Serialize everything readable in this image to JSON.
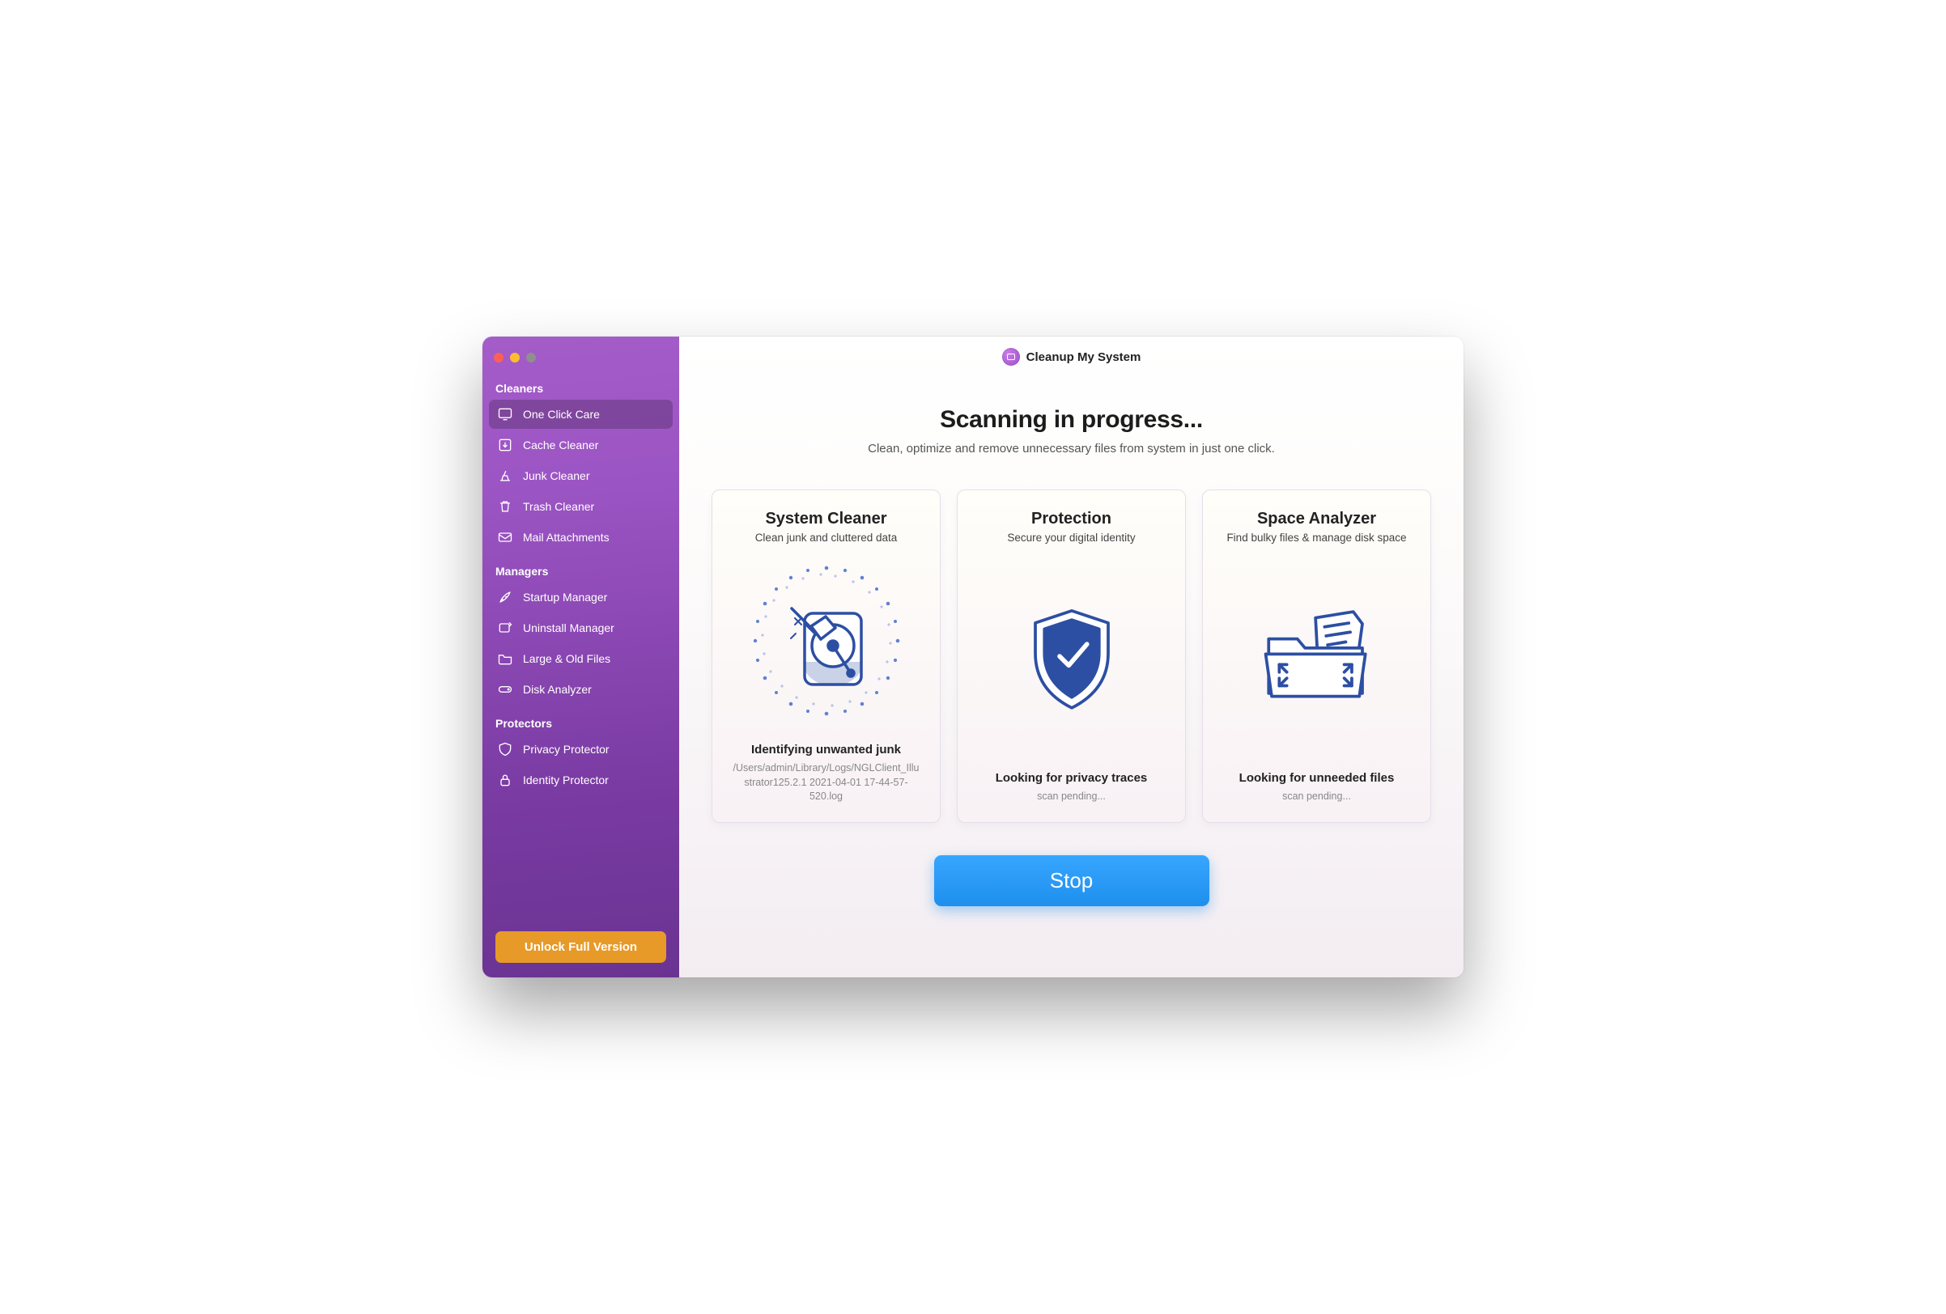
{
  "app": {
    "title": "Cleanup My System"
  },
  "sidebar": {
    "sections": [
      {
        "title": "Cleaners",
        "items": [
          {
            "label": "One Click Care",
            "active": true
          },
          {
            "label": "Cache Cleaner"
          },
          {
            "label": "Junk Cleaner"
          },
          {
            "label": "Trash Cleaner"
          },
          {
            "label": "Mail Attachments"
          }
        ]
      },
      {
        "title": "Managers",
        "items": [
          {
            "label": "Startup Manager"
          },
          {
            "label": "Uninstall Manager"
          },
          {
            "label": "Large & Old Files"
          },
          {
            "label": "Disk Analyzer"
          }
        ]
      },
      {
        "title": "Protectors",
        "items": [
          {
            "label": "Privacy Protector"
          },
          {
            "label": "Identity Protector"
          }
        ]
      }
    ],
    "unlock_label": "Unlock Full Version"
  },
  "hero": {
    "title": "Scanning in progress...",
    "subtitle": "Clean, optimize and remove unnecessary files from system in just one click."
  },
  "cards": [
    {
      "title": "System Cleaner",
      "subtitle": "Clean junk and cluttered data",
      "status": "Identifying unwanted junk",
      "detail": "/Users/admin/Library/Logs/NGLClient_Illustrator125.2.1 2021-04-01 17-44-57-520.log"
    },
    {
      "title": "Protection",
      "subtitle": "Secure your digital identity",
      "status": "Looking for privacy traces",
      "detail": "scan pending..."
    },
    {
      "title": "Space Analyzer",
      "subtitle": "Find bulky files & manage disk space",
      "status": "Looking for unneeded files",
      "detail": "scan pending..."
    }
  ],
  "actions": {
    "stop_label": "Stop"
  }
}
